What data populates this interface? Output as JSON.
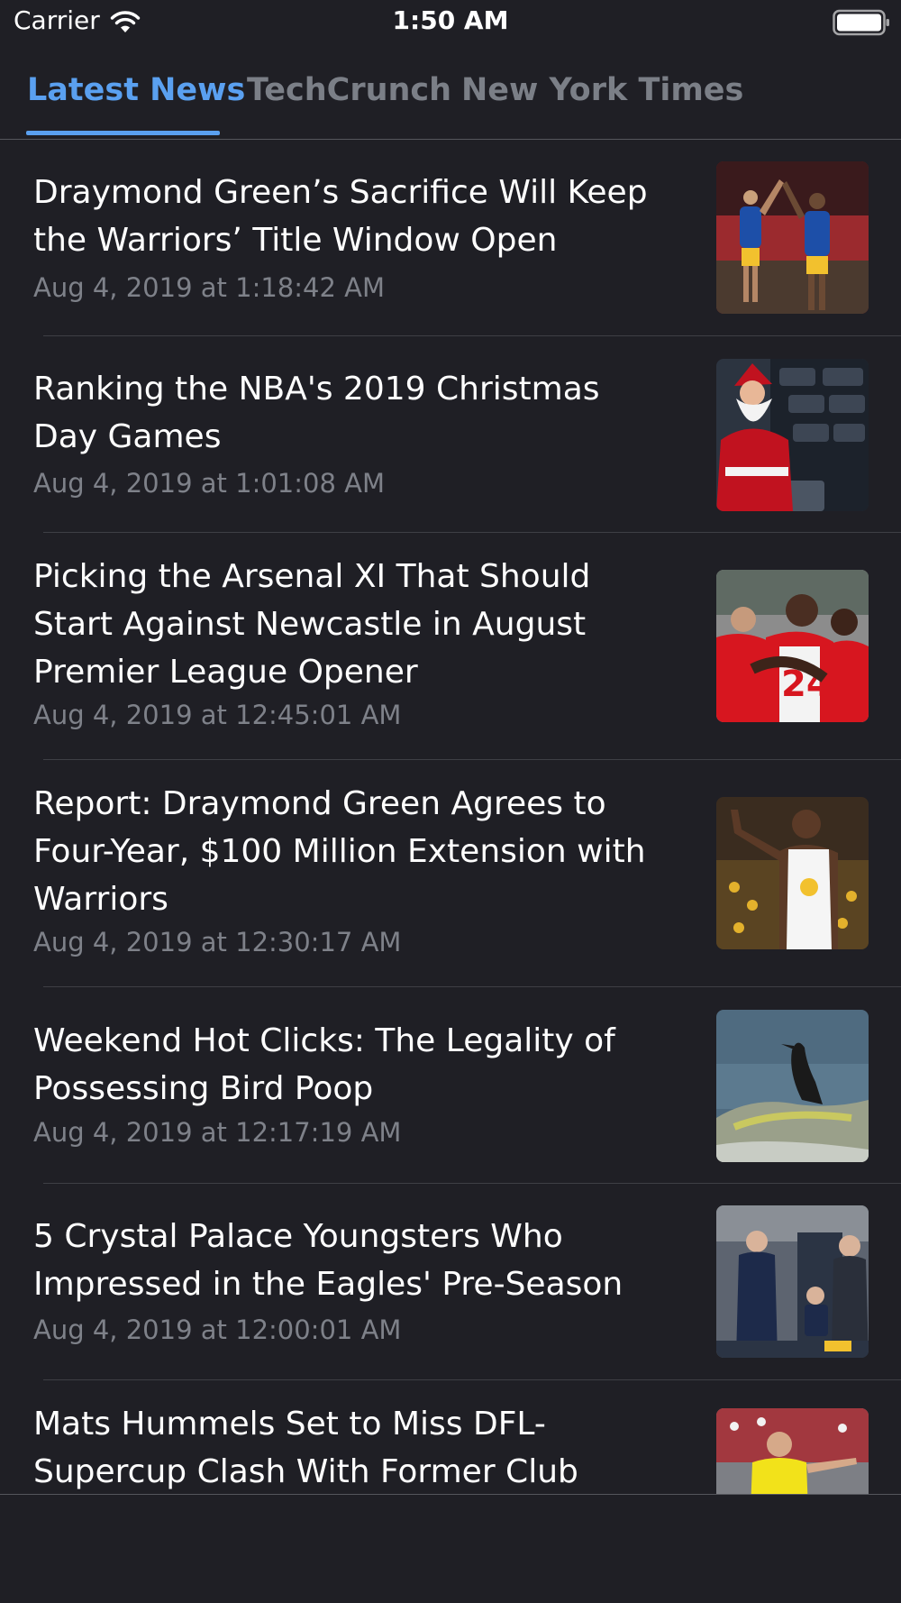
{
  "status_bar": {
    "carrier": "Carrier",
    "time": "1:50 AM"
  },
  "tabs": [
    {
      "label": "Latest News",
      "active": true
    },
    {
      "label": "TechCrunch",
      "active": false
    },
    {
      "label": "New York Times",
      "active": false
    }
  ],
  "colors": {
    "background": "#1f1f25",
    "accent": "#5aa0f0",
    "inactive_tab": "#7b7f87",
    "timestamp": "#7e8189"
  },
  "articles": [
    {
      "title": "Draymond Green’s Sacrifice Will Keep the Warriors’ Title Window Open",
      "date": "Aug 4, 2019 at 1:18:42 AM",
      "image": "basketball-players-high-five-icon"
    },
    {
      "title": "Ranking the NBA's 2019 Christmas Day Games",
      "date": "Aug 4, 2019 at 1:01:08 AM",
      "image": "santa-claus-in-arena-seats-icon"
    },
    {
      "title": "Picking the Arsenal XI That Should Start Against Newcastle in August Premier League Opener",
      "date": "Aug 4, 2019 at 12:45:01 AM",
      "image": "arsenal-players-celebrating-icon"
    },
    {
      "title": "Report: Draymond Green Agrees to Four-Year, $100 Million Extension with Warriors",
      "date": "Aug 4, 2019 at 12:30:17 AM",
      "image": "draymond-green-gesturing-icon"
    },
    {
      "title": "Weekend Hot Clicks: The Legality of Possessing Bird Poop",
      "date": "Aug 4, 2019 at 12:17:19 AM",
      "image": "cormorant-on-rock-icon"
    },
    {
      "title": "5 Crystal Palace Youngsters Who Impressed in the Eagles' Pre-Season",
      "date": "Aug 4, 2019 at 12:00:01 AM",
      "image": "crystal-palace-bench-icon"
    },
    {
      "title": "Mats Hummels Set to Miss DFL-Supercup Clash With Former Club",
      "date": "",
      "image": "dortmund-player-icon"
    }
  ]
}
